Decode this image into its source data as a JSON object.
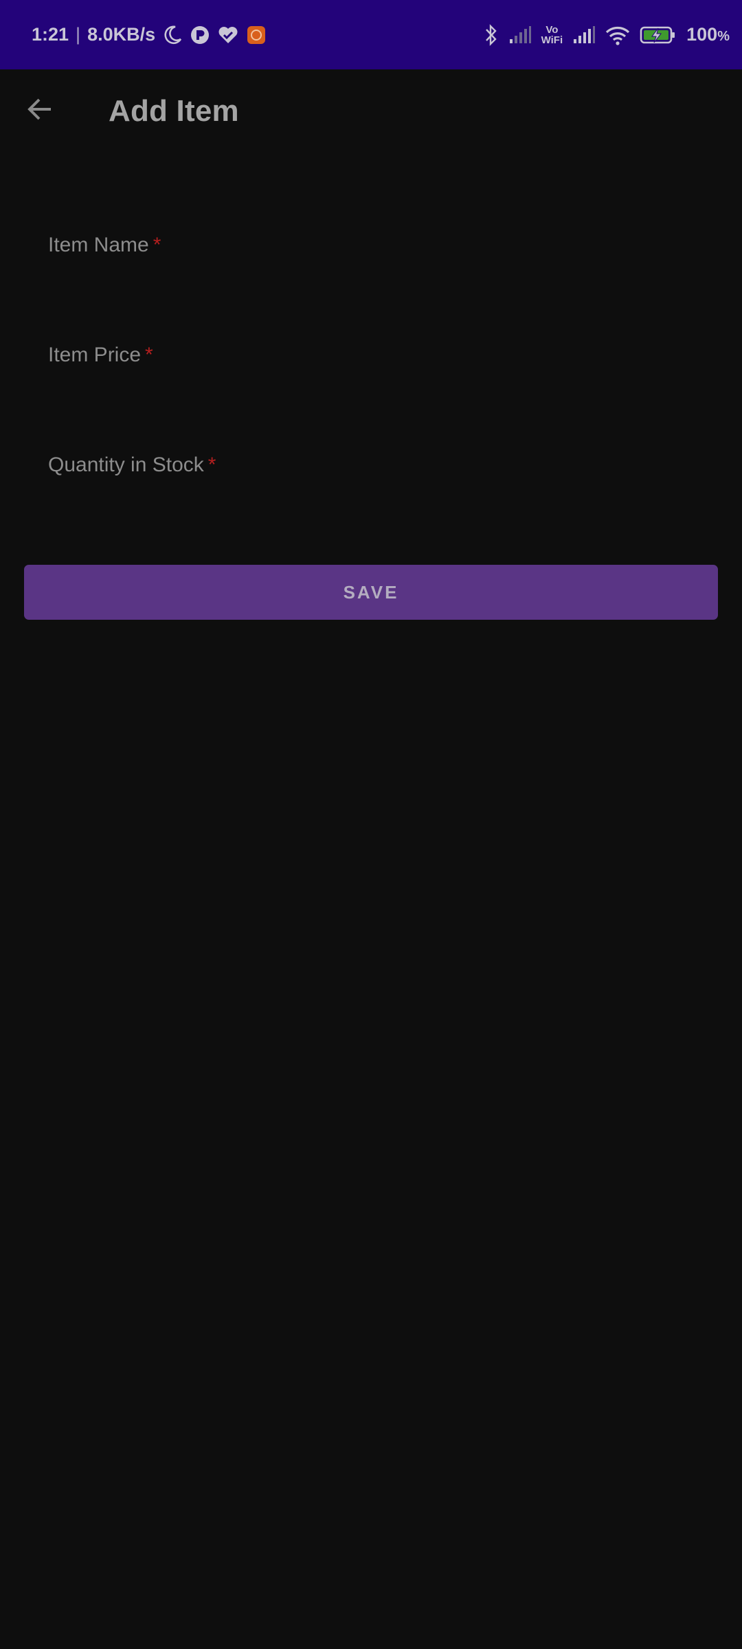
{
  "status_bar": {
    "time": "1:21",
    "separator": "|",
    "network_speed": "8.0KB/s",
    "left_icons": [
      "moon-icon",
      "p-badge-icon",
      "heart-check-icon",
      "app-notification-icon"
    ],
    "right_icons": [
      "bluetooth-icon",
      "signal-weak-icon",
      "signal-icon",
      "wifi-icon",
      "battery-charging-icon"
    ],
    "vowifi_top": "Vo",
    "vowifi_bottom": "WiFi",
    "battery_level": "100",
    "battery_unit": "%",
    "background_color": "#23037a"
  },
  "app_bar": {
    "title": "Add Item",
    "back_icon": "arrow-back-icon"
  },
  "form": {
    "fields": [
      {
        "label": "Item Name",
        "required_mark": "*",
        "value": ""
      },
      {
        "label": "Item Price",
        "required_mark": "*",
        "value": ""
      },
      {
        "label": "Quantity in Stock",
        "required_mark": "*",
        "value": ""
      }
    ],
    "save_label": "SAVE"
  },
  "colors": {
    "background": "#0e0e0e",
    "accent": "#5a3585",
    "required": "#b31f1f",
    "label": "#8d8d8d"
  }
}
